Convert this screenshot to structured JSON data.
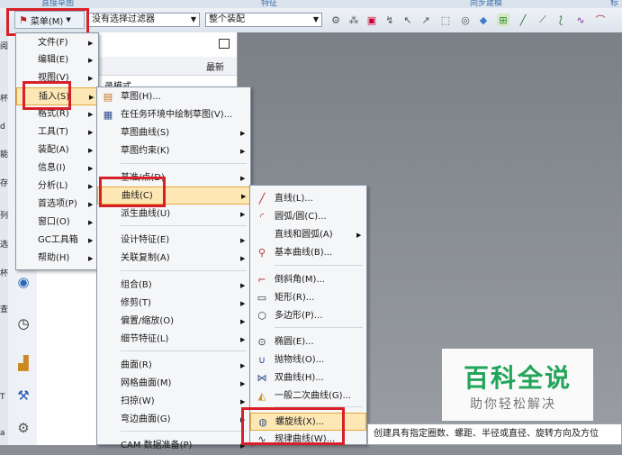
{
  "top_tabs": [
    "直接草图",
    "特征",
    "同步建模",
    "标"
  ],
  "toolbar": {
    "menu_label": "菜单(M)",
    "filter_value": "没有选择过滤器",
    "assembly_value": "整个装配"
  },
  "left_strip_chars": [
    "阅",
    "杯",
    "d",
    "能",
    "存",
    "列",
    "选",
    "杯",
    "查",
    "T",
    "a"
  ],
  "panel": {
    "column_latest": "最新",
    "mode_text": "录模式"
  },
  "main_menu": [
    {
      "label": "文件(F)",
      "has_sub": true
    },
    {
      "label": "编辑(E)",
      "has_sub": true
    },
    {
      "label": "视图(V)",
      "has_sub": true
    },
    {
      "label": "插入(S)",
      "has_sub": true,
      "highlighted": true
    },
    {
      "label": "格式(R)",
      "has_sub": true
    },
    {
      "label": "工具(T)",
      "has_sub": true
    },
    {
      "label": "装配(A)",
      "has_sub": true
    },
    {
      "label": "信息(I)",
      "has_sub": true
    },
    {
      "label": "分析(L)",
      "has_sub": true
    },
    {
      "label": "首选项(P)",
      "has_sub": true
    },
    {
      "label": "窗口(O)",
      "has_sub": true
    },
    {
      "label": "GC工具箱",
      "has_sub": true
    },
    {
      "label": "帮助(H)",
      "has_sub": true
    }
  ],
  "insert_menu": [
    {
      "label": "草图(H)...",
      "icon": "sketch-icon"
    },
    {
      "label": "在任务环境中绘制草图(V)...",
      "icon": "task-sketch-icon"
    },
    {
      "label": "草图曲线(S)",
      "has_sub": true
    },
    {
      "label": "草图约束(K)",
      "has_sub": true
    },
    {
      "label": "基准/点(D)",
      "has_sub": true
    },
    {
      "label": "曲线(C)",
      "has_sub": true,
      "highlighted": true
    },
    {
      "label": "派生曲线(U)",
      "has_sub": true
    },
    {
      "label": "设计特征(E)",
      "has_sub": true
    },
    {
      "label": "关联复制(A)",
      "has_sub": true
    },
    {
      "label": "组合(B)",
      "has_sub": true
    },
    {
      "label": "修剪(T)",
      "has_sub": true
    },
    {
      "label": "偏置/缩放(O)",
      "has_sub": true
    },
    {
      "label": "细节特征(L)",
      "has_sub": true
    },
    {
      "label": "曲面(R)",
      "has_sub": true
    },
    {
      "label": "网格曲面(M)",
      "has_sub": true
    },
    {
      "label": "扫掠(W)",
      "has_sub": true
    },
    {
      "label": "弯边曲面(G)",
      "has_sub": true
    },
    {
      "label": "CAM 数据准备(P)",
      "has_sub": true
    }
  ],
  "curve_menu": [
    {
      "label": "直线(L)...",
      "icon": "line-icon"
    },
    {
      "label": "圆弧/圆(C)...",
      "icon": "arc-icon"
    },
    {
      "label": "直线和圆弧(A)",
      "has_sub": true
    },
    {
      "label": "基本曲线(B)...",
      "icon": "basic-curve-icon"
    },
    {
      "label": "倒斜角(M)...",
      "icon": "chamfer-icon"
    },
    {
      "label": "矩形(R)...",
      "icon": "rectangle-icon"
    },
    {
      "label": "多边形(P)...",
      "icon": "polygon-icon"
    },
    {
      "label": "椭圆(E)...",
      "icon": "ellipse-icon"
    },
    {
      "label": "抛物线(O)...",
      "icon": "parabola-icon"
    },
    {
      "label": "双曲线(H)...",
      "icon": "hyperbola-icon"
    },
    {
      "label": "一般二次曲线(G)...",
      "icon": "conic-icon"
    },
    {
      "label": "螺旋线(X)...",
      "icon": "helix-icon",
      "highlighted": true
    },
    {
      "label": "规律曲线(W)...",
      "icon": "law-curve-icon"
    }
  ],
  "tooltip": "创建具有指定圈数、螺距、半径或直径、旋转方向及方位",
  "watermark": {
    "title": "百科全说",
    "subtitle": "助你轻松解决"
  },
  "colors": {
    "highlight_red": "#d8202a",
    "hover_fill": "#fde7b4",
    "watermark_green": "#22a55a"
  }
}
